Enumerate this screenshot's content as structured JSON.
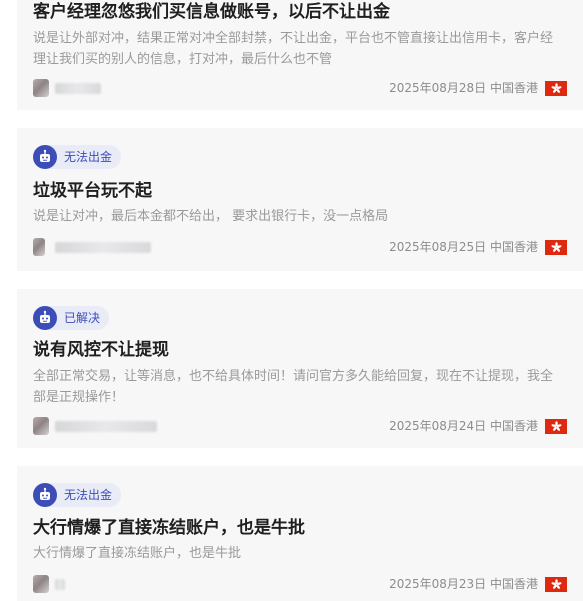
{
  "posts": [
    {
      "title": "客户经理忽悠我们买信息做账号，以后不让出金",
      "description": "说是让外部对冲，结果正常对冲全部封禁，不让出金，平台也不管直接让出信用卡，客户经理让我们买的别人的信息，打对冲，最后什么也不管",
      "date": "2025年08月28日",
      "region": "中国香港",
      "flag_icon": "hong-kong-flag-icon"
    },
    {
      "badge": "无法出金",
      "title": "垃圾平台玩不起",
      "description": "说是让对冲，最后本金都不给出， 要求出银行卡，没一点格局",
      "date": "2025年08月25日",
      "region": "中国香港",
      "flag_icon": "hong-kong-flag-icon"
    },
    {
      "badge": "已解决",
      "title": "说有风控不让提现",
      "description": "全部正常交易，让等消息，也不给具体时间！请问官方多久能给回复，现在不让提现，我全部是正规操作！",
      "date": "2025年08月24日",
      "region": "中国香港",
      "flag_icon": "hong-kong-flag-icon"
    },
    {
      "badge": "无法出金",
      "title": "大行情爆了直接冻结账户，也是牛批",
      "description": "大行情爆了直接冻结账户，也是牛批",
      "date": "2025年08月23日",
      "region": "中国香港",
      "flag_icon": "hong-kong-flag-icon"
    }
  ],
  "colors": {
    "badge_accent": "#3d4db8",
    "badge_bg": "#e9ebf7",
    "flag_red": "#de2910",
    "card_bg": "#f7f7f8"
  }
}
